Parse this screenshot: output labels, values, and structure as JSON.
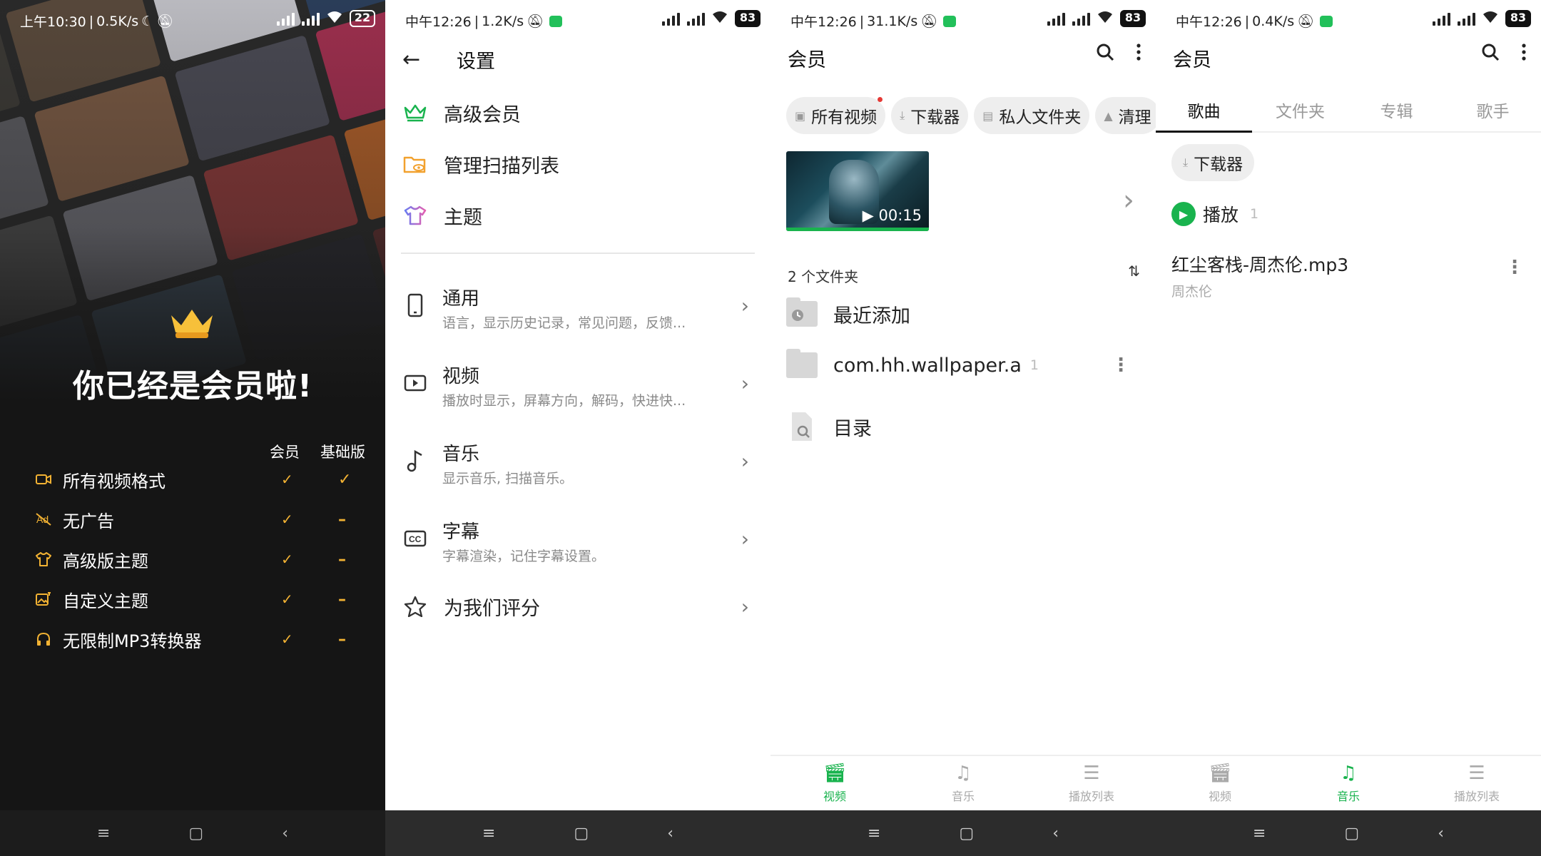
{
  "screen1": {
    "status": {
      "time": "上午10:30",
      "speed": "0.5K/s",
      "battery": "22"
    },
    "title": "你已经是会员啦!",
    "columns": {
      "member": "会员",
      "basic": "基础版"
    },
    "features": [
      {
        "label": "所有视频格式",
        "icon": "video-format-icon",
        "member": "✓",
        "basic": "✓"
      },
      {
        "label": "无广告",
        "icon": "no-ads-icon",
        "member": "✓",
        "basic": "–"
      },
      {
        "label": "高级版主题",
        "icon": "shirt-icon",
        "member": "✓",
        "basic": "–"
      },
      {
        "label": "自定义主题",
        "icon": "image-edit-icon",
        "member": "✓",
        "basic": "–"
      },
      {
        "label": "无限制MP3转换器",
        "icon": "headphones-icon",
        "member": "✓",
        "basic": "–"
      }
    ]
  },
  "screen2": {
    "status": {
      "time": "中午12:26",
      "speed": "1.2K/s",
      "battery": "83"
    },
    "title": "设置",
    "top_items": [
      {
        "label": "高级会员",
        "icon": "crown-icon"
      },
      {
        "label": "管理扫描列表",
        "icon": "folder-eye-icon"
      },
      {
        "label": "主题",
        "icon": "shirt-icon"
      }
    ],
    "settings": [
      {
        "title": "通用",
        "desc": "语言，显示历史记录，常见问题，反馈...",
        "icon": "phone-icon"
      },
      {
        "title": "视频",
        "desc": "播放时显示，屏幕方向，解码，快进快...",
        "icon": "video-icon"
      },
      {
        "title": "音乐",
        "desc": "显示音乐, 扫描音乐。",
        "icon": "music-note-icon"
      },
      {
        "title": "字幕",
        "desc": "字幕渲染，记住字幕设置。",
        "icon": "cc-icon"
      }
    ],
    "rate": "为我们评分"
  },
  "screen3": {
    "status": {
      "time": "中午12:26",
      "speed": "31.1K/s",
      "battery": "83"
    },
    "title": "会员",
    "chips": [
      "所有视频",
      "下载器",
      "私人文件夹",
      "清理"
    ],
    "video_duration": "00:15",
    "folder_count": "2 个文件夹",
    "folders": [
      {
        "label": "最近添加",
        "count": ""
      },
      {
        "label": "com.hh.wallpaper.a",
        "count": "1"
      }
    ],
    "catalog": "目录",
    "tabs": [
      "视频",
      "音乐",
      "播放列表"
    ],
    "active_tab": "视频"
  },
  "screen4": {
    "status": {
      "time": "中午12:26",
      "speed": "0.4K/s",
      "battery": "83"
    },
    "title": "会员",
    "tabs": [
      "歌曲",
      "文件夹",
      "专辑",
      "歌手"
    ],
    "chip": "下载器",
    "play": {
      "label": "播放",
      "count": "1"
    },
    "song": {
      "title": "红尘客栈-周杰伦.mp3",
      "artist": "周杰伦"
    },
    "bottom_tabs": [
      "视频",
      "音乐",
      "播放列表"
    ],
    "active_tab": "音乐"
  },
  "colors": {
    "accent_green": "#19b34e",
    "gold": "#f2b233",
    "dark_bg": "#151515"
  }
}
